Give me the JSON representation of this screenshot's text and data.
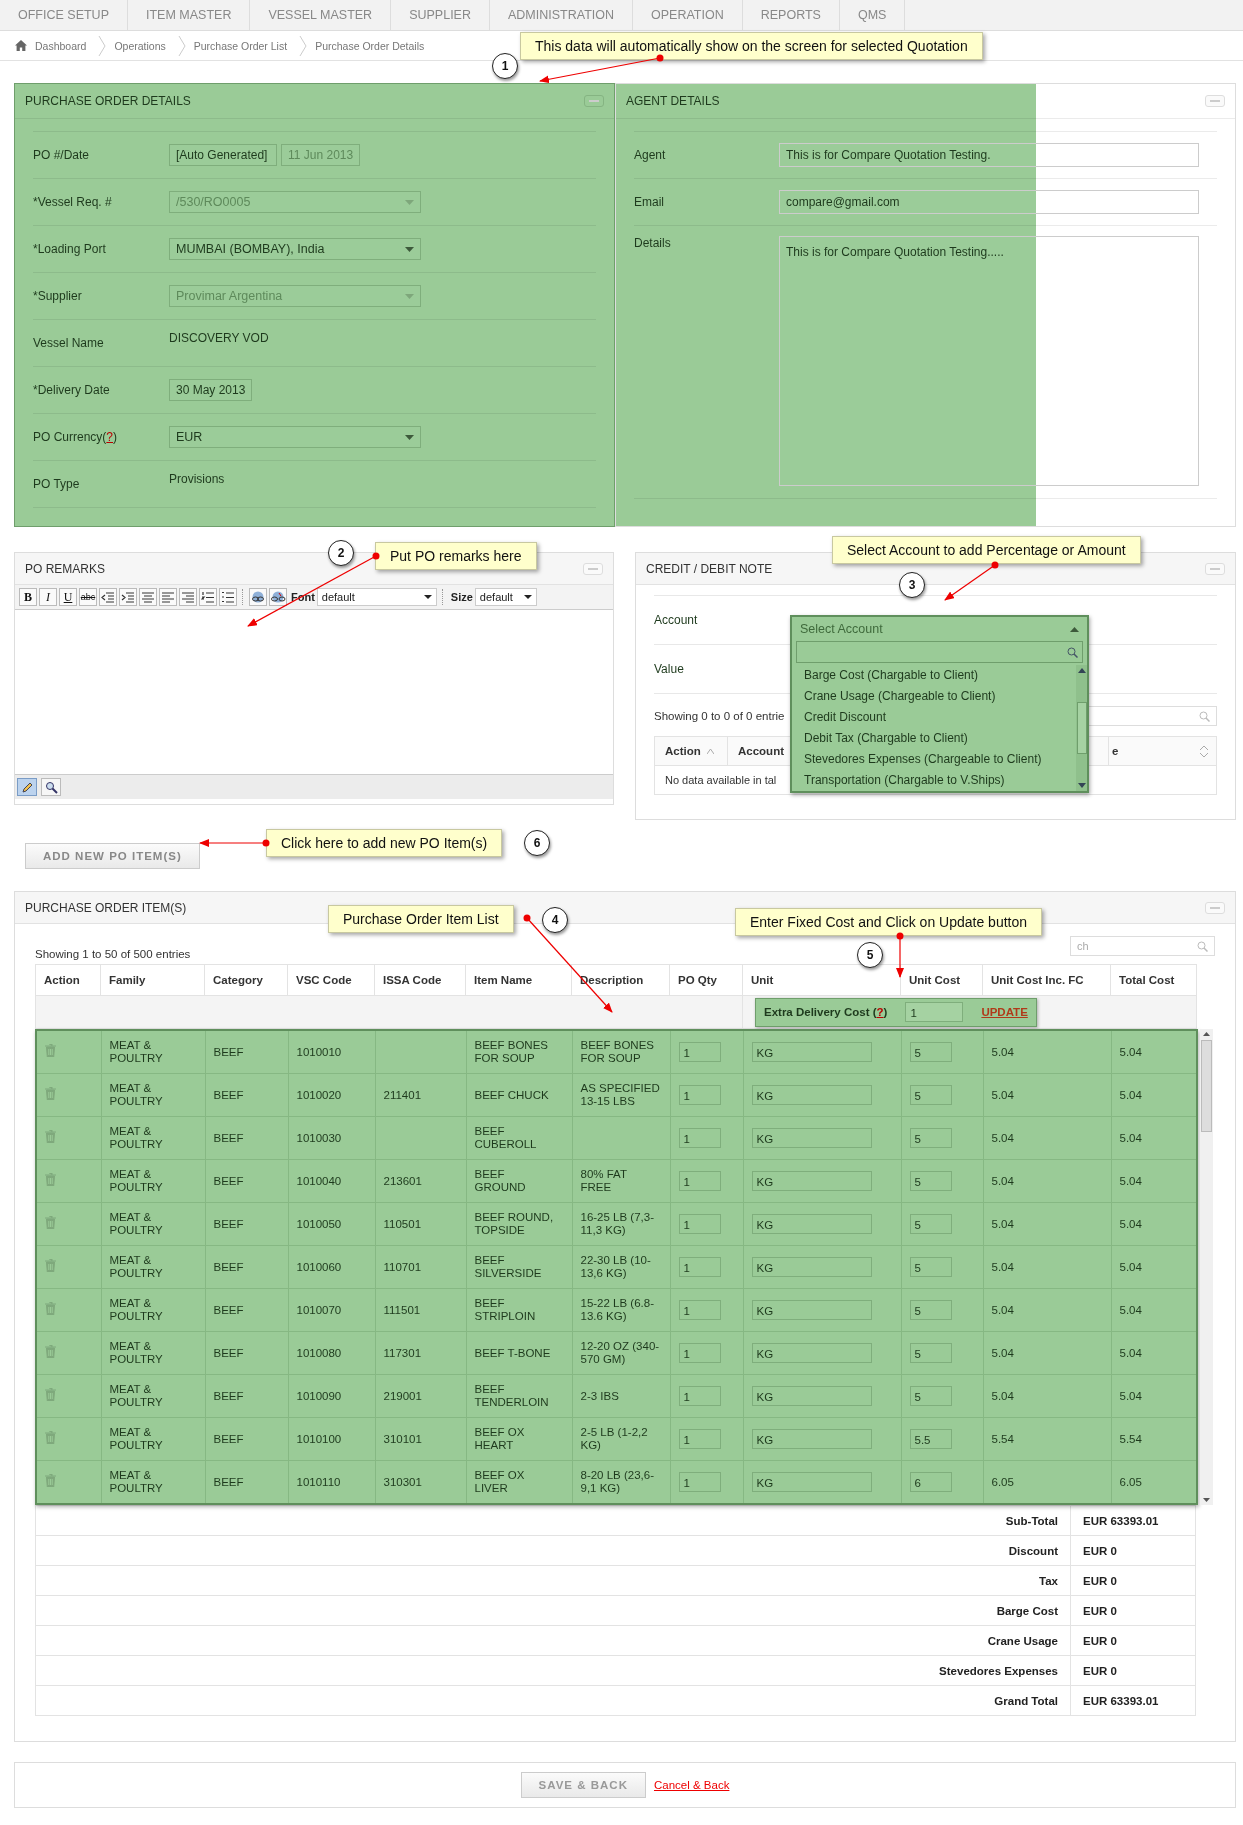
{
  "nav_tabs": [
    "OFFICE SETUP",
    "ITEM MASTER",
    "VESSEL MASTER",
    "SUPPLIER",
    "ADMINISTRATION",
    "OPERATION",
    "REPORTS",
    "QMS"
  ],
  "breadcrumb": [
    "Dashboard",
    "Operations",
    "Purchase Order List",
    "Purchase Order Details"
  ],
  "callouts": [
    {
      "number": "1",
      "text": "This data will automatically show on the screen for selected Quotation"
    },
    {
      "number": "2",
      "text": "Put PO remarks here"
    },
    {
      "number": "3",
      "text": "Select Account to add Percentage or Amount"
    },
    {
      "number": "4",
      "text": "Purchase Order Item List"
    },
    {
      "number": "5",
      "text": "Enter Fixed Cost and Click on Update button"
    },
    {
      "number": "6",
      "text": "Click here to add new PO Item(s)"
    }
  ],
  "po_details": {
    "title": "PURCHASE ORDER DETAILS",
    "rows": [
      {
        "label": "PO #/Date",
        "kind": "pair",
        "values": [
          {
            "text": "[Auto Generated]",
            "disabled": false
          },
          {
            "text": "11 Jun 2013",
            "disabled": true
          }
        ]
      },
      {
        "label": "*Vessel Req. #",
        "kind": "select",
        "value": "/530/RO0005",
        "disabled": true
      },
      {
        "label": "*Loading Port",
        "kind": "select",
        "value": "MUMBAI (BOMBAY), India",
        "disabled": false
      },
      {
        "label": "*Supplier",
        "kind": "select",
        "value": "Provimar Argentina",
        "disabled": true
      },
      {
        "label": "Vessel Name",
        "kind": "static",
        "value": "DISCOVERY VOD"
      },
      {
        "label": "*Delivery Date",
        "kind": "date",
        "value": "30 May 2013"
      },
      {
        "label": "PO Currency(",
        "help": "?",
        "label_end": ")",
        "kind": "select",
        "value": "EUR",
        "disabled": false
      },
      {
        "label": "PO Type",
        "kind": "static",
        "value": "Provisions"
      }
    ]
  },
  "agent_details": {
    "title": "AGENT DETAILS",
    "rows": [
      {
        "label": "Agent",
        "kind": "input",
        "value": "This is for Compare Quotation Testing."
      },
      {
        "label": "Email",
        "kind": "input",
        "value": "compare@gmail.com"
      },
      {
        "label": "Details",
        "kind": "textarea",
        "value": "This is for Compare Quotation Testing....."
      }
    ]
  },
  "po_remarks": {
    "title": "PO REMARKS",
    "format_buttons": [
      "B",
      "I",
      "U",
      "abc"
    ],
    "font_label": "Font",
    "font_value": "default",
    "size_label": "Size",
    "size_value": "default"
  },
  "credit_debit": {
    "title": "CREDIT / DEBIT NOTE",
    "fields": [
      "Account",
      "Value"
    ],
    "showing": "Showing 0 to 0 of 0 entrie",
    "columns": [
      "Action",
      "Account",
      "e"
    ],
    "empty_text": "No data available in tal",
    "dropdown": {
      "placeholder": "Select Account",
      "options": [
        "Barge Cost (Chargable to Client)",
        "Crane Usage (Chargeable to Client)",
        "Credit Discount",
        "Debit Tax (Chargable to Client)",
        "Stevedores Expenses (Chargeable to Client)",
        "Transportation (Chargable to V.Ships)"
      ]
    }
  },
  "add_button": "ADD NEW PO ITEM(S)",
  "po_items": {
    "title": "PURCHASE ORDER ITEM(S)",
    "showing": "Showing 1 to 50 of 500 entries",
    "search_placeholder": "ch",
    "columns": [
      "Action",
      "Family",
      "Category",
      "VSC Code",
      "ISSA Code",
      "Item Name",
      "Description",
      "PO Qty",
      "Unit",
      "Unit Cost",
      "Unit Cost Inc. FC",
      "Total Cost"
    ],
    "extra_cost": {
      "label": "Extra Delivery Cost (",
      "help": "?",
      "label_end": ")",
      "value": "1",
      "button": "UPDATE"
    },
    "rows": [
      {
        "family": "MEAT & POULTRY",
        "category": "BEEF",
        "vsc": "1010010",
        "item": "BEEF BONES FOR SOUP",
        "description": "BEEF BONES FOR SOUP",
        "qty": "1",
        "unit": "KG",
        "unit_cost": "5",
        "unit_cost_fc": "5.04",
        "total": "5.04"
      },
      {
        "family": "MEAT & POULTRY",
        "category": "BEEF",
        "vsc": "1010020",
        "issa": "211401",
        "item": "BEEF CHUCK",
        "description": "AS SPECIFIED 13-15 LBS",
        "qty": "1",
        "unit": "KG",
        "unit_cost": "5",
        "unit_cost_fc": "5.04",
        "total": "5.04"
      },
      {
        "family": "MEAT & POULTRY",
        "category": "BEEF",
        "vsc": "1010030",
        "item": "BEEF CUBEROLL",
        "qty": "1",
        "unit": "KG",
        "unit_cost": "5",
        "unit_cost_fc": "5.04",
        "total": "5.04"
      },
      {
        "family": "MEAT & POULTRY",
        "category": "BEEF",
        "vsc": "1010040",
        "issa": "213601",
        "item": "BEEF GROUND",
        "description": "80% FAT FREE",
        "qty": "1",
        "unit": "KG",
        "unit_cost": "5",
        "unit_cost_fc": "5.04",
        "total": "5.04"
      },
      {
        "family": "MEAT & POULTRY",
        "category": "BEEF",
        "vsc": "1010050",
        "issa": "110501",
        "item": "BEEF ROUND, TOPSIDE",
        "description": "16-25 LB (7,3-11,3 KG)",
        "qty": "1",
        "unit": "KG",
        "unit_cost": "5",
        "unit_cost_fc": "5.04",
        "total": "5.04"
      },
      {
        "family": "MEAT & POULTRY",
        "category": "BEEF",
        "vsc": "1010060",
        "issa": "110701",
        "item": "BEEF SILVERSIDE",
        "description": "22-30 LB (10-13,6 KG)",
        "qty": "1",
        "unit": "KG",
        "unit_cost": "5",
        "unit_cost_fc": "5.04",
        "total": "5.04"
      },
      {
        "family": "MEAT & POULTRY",
        "category": "BEEF",
        "vsc": "1010070",
        "issa": "111501",
        "item": "BEEF STRIPLOIN",
        "description": "15-22 LB (6.8-13.6 KG)",
        "qty": "1",
        "unit": "KG",
        "unit_cost": "5",
        "unit_cost_fc": "5.04",
        "total": "5.04"
      },
      {
        "family": "MEAT & POULTRY",
        "category": "BEEF",
        "vsc": "1010080",
        "issa": "117301",
        "item": "BEEF T-BONE",
        "description": "12-20 OZ (340-570 GM)",
        "qty": "1",
        "unit": "KG",
        "unit_cost": "5",
        "unit_cost_fc": "5.04",
        "total": "5.04"
      },
      {
        "family": "MEAT & POULTRY",
        "category": "BEEF",
        "vsc": "1010090",
        "issa": "219001",
        "item": "BEEF TENDERLOIN",
        "description": "2-3 IBS",
        "qty": "1",
        "unit": "KG",
        "unit_cost": "5",
        "unit_cost_fc": "5.04",
        "total": "5.04"
      },
      {
        "family": "MEAT & POULTRY",
        "category": "BEEF",
        "vsc": "1010100",
        "issa": "310101",
        "item": "BEEF OX HEART",
        "description": "2-5 LB (1-2,2 KG)",
        "qty": "1",
        "unit": "KG",
        "unit_cost": "5.5",
        "unit_cost_fc": "5.54",
        "total": "5.54"
      },
      {
        "family": "MEAT & POULTRY",
        "category": "BEEF",
        "vsc": "1010110",
        "issa": "310301",
        "item": "BEEF OX LIVER",
        "description": "8-20 LB (23,6-9,1 KG)",
        "qty": "1",
        "unit": "KG",
        "unit_cost": "6",
        "unit_cost_fc": "6.05",
        "total": "6.05"
      }
    ],
    "totals": [
      {
        "label": "Sub-Total",
        "value": "EUR 63393.01"
      },
      {
        "label": "Discount",
        "value": "EUR 0"
      },
      {
        "label": "Tax",
        "value": "EUR 0"
      },
      {
        "label": "Barge Cost",
        "value": "EUR 0"
      },
      {
        "label": "Crane Usage",
        "value": "EUR 0"
      },
      {
        "label": "Stevedores Expenses",
        "value": "EUR 0"
      },
      {
        "label": "Grand Total",
        "value": "EUR 63393.01"
      }
    ]
  },
  "footer": {
    "save": "SAVE & BACK",
    "cancel": "Cancel & Back"
  }
}
